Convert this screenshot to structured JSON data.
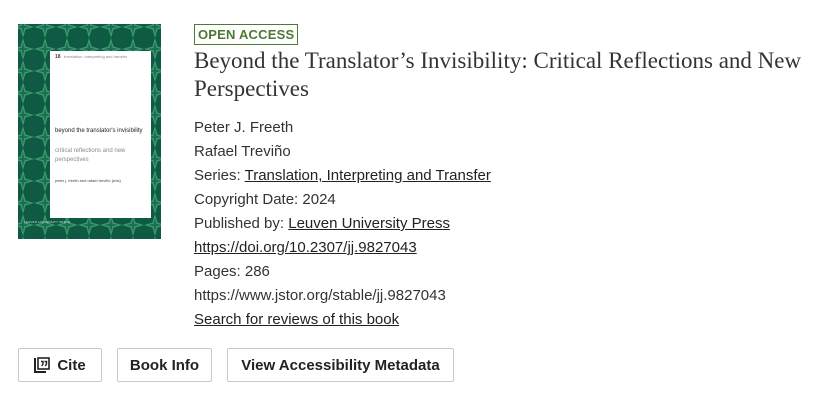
{
  "cover": {
    "series_number": "18",
    "series_name": "translation, interpreting and transfer",
    "title_lines": "beyond the translator's invisibility",
    "subtitle_lines": "critical reflections and new perspectives",
    "authors_line": "peter j. freeth and rafael treviño (eds)",
    "publisher_line": "LEUVEN UNIVERSITY PRESS",
    "colors": {
      "background": "#0f5a43",
      "panel": "#ffffff"
    }
  },
  "book": {
    "badge": "OPEN ACCESS",
    "title": "Beyond the Translator’s Invisibility: Critical Reflections and New Perspectives",
    "authors": [
      "Peter J. Freeth",
      "Rafael Treviño"
    ],
    "series_label": "Series:",
    "series_link": "Translation, Interpreting and Transfer",
    "copyright_label": "Copyright Date:",
    "copyright_value": "2024",
    "publisher_label": "Published by:",
    "publisher_link": "Leuven University Press",
    "doi_link": "https://doi.org/10.2307/jj.9827043",
    "pages_label": "Pages:",
    "pages_value": "286",
    "stable_url": "https://www.jstor.org/stable/jj.9827043",
    "reviews_link": "Search for reviews of this book"
  },
  "actions": {
    "cite": "Cite",
    "cite_icon": "cite-icon",
    "book_info": "Book Info",
    "accessibility": "View Accessibility Metadata"
  },
  "colors": {
    "badge": "#4c7a32",
    "text": "#333333"
  }
}
